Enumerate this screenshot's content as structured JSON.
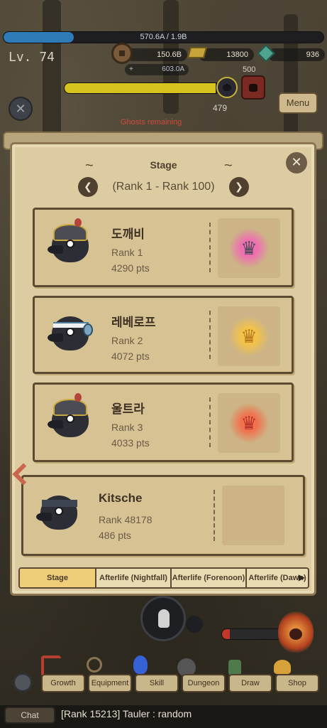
{
  "hud": {
    "hp_text": "570.6A / 1.9B",
    "level": "Lv. 74",
    "currency_1": "150.6B",
    "currency_2": "13800",
    "currency_3": "936",
    "sub_prefix": "+",
    "sub_value": "603.0A",
    "boss_value": "500",
    "key_value": "479",
    "menu_label": "Menu",
    "ghost_text": "Ghosts remaining",
    "hp_fraction": 0.22,
    "xp_fraction": 0.97
  },
  "panel": {
    "title": "Stage",
    "range": "(Rank 1 - Rank 100)",
    "prev_icon": "chevron-left-icon",
    "next_icon": "chevron-right-icon",
    "close_icon": "close-icon",
    "entries": [
      {
        "name": "도깨비",
        "rank": "Rank 1",
        "pts": "4290 pts",
        "emblem_color": "#ee6fb0",
        "emblem_icon": "crown-icon"
      },
      {
        "name": "레베로프",
        "rank": "Rank 2",
        "pts": "4072 pts",
        "emblem_color": "#f3c24a",
        "emblem_icon": "crown-icon"
      },
      {
        "name": "울트라",
        "rank": "Rank 3",
        "pts": "4033 pts",
        "emblem_color": "#f0724e",
        "emblem_icon": "crown-icon"
      }
    ],
    "self": {
      "name": "Kitsche",
      "rank": "Rank 48178",
      "pts": "486 pts"
    },
    "tabs": [
      "Stage",
      "Afterlife (Nightfall)",
      "Afterlife (Forenoon)",
      "Afterlife (Dawn)"
    ],
    "active_tab": 0
  },
  "nav": {
    "items": [
      "Growth",
      "Equipment",
      "Skill",
      "Dungeon",
      "Draw",
      "Shop"
    ]
  },
  "chat": {
    "button_label": "Chat",
    "message": "[Rank 15213] Tauler : random"
  },
  "colors": {
    "accent_tab": "#f0cd79",
    "hp_fill": "#2f7bb8",
    "xp_fill": "#d8c21e"
  }
}
